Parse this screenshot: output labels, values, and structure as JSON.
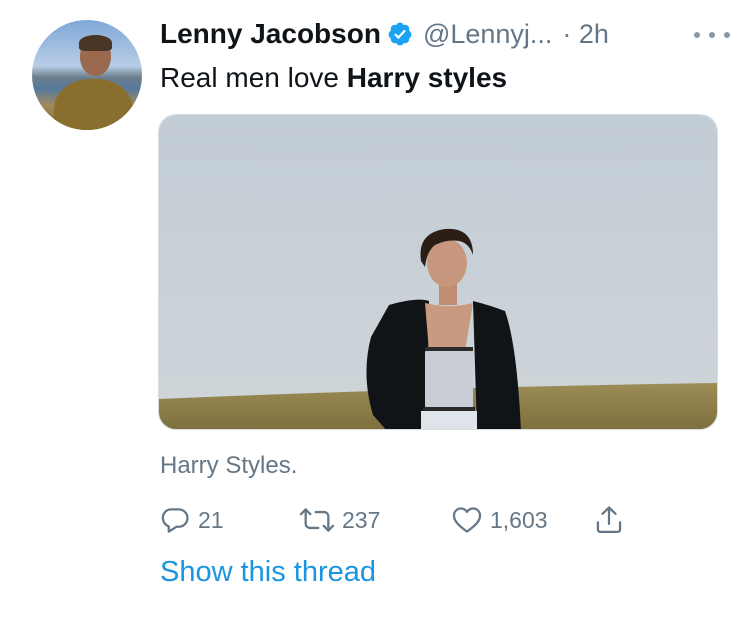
{
  "tweet": {
    "author_name": "Lenny Jacobson",
    "handle": "@Lennyj...",
    "time": "· 2h",
    "text_plain": "Real men love ",
    "text_bold": "Harry styles",
    "caption": "Harry Styles.",
    "verified_icon": "verified-badge-icon",
    "more_icon": "more-dots-icon"
  },
  "actions": {
    "reply_count": "21",
    "retweet_count": "237",
    "like_count": "1,603",
    "reply_icon": "reply-bubble-icon",
    "retweet_icon": "retweet-icon",
    "like_icon": "heart-icon",
    "share_icon": "share-icon"
  },
  "thread": {
    "show_label": "Show this thread"
  },
  "colors": {
    "text": "#0f1419",
    "secondary": "#657786",
    "link": "#1b95e0",
    "verified": "#1da1f2"
  }
}
